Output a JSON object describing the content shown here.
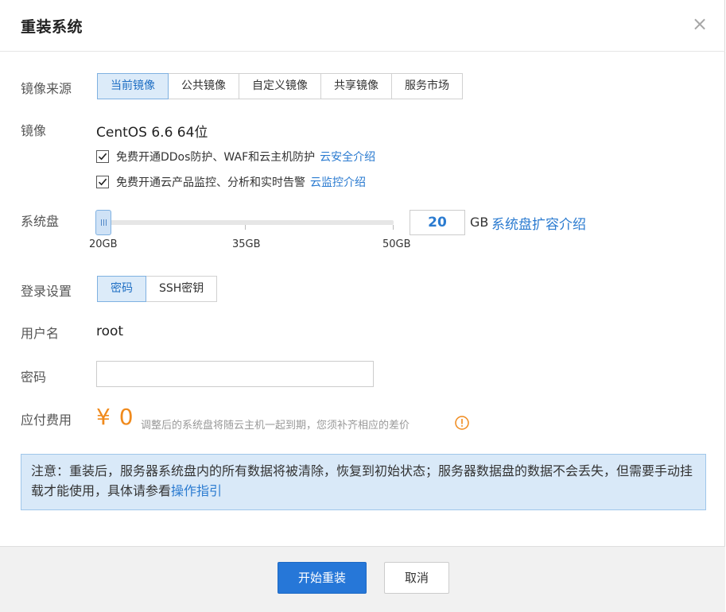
{
  "dialog": {
    "title": "重装系统"
  },
  "labels": {
    "image_source": "镜像来源",
    "image": "镜像",
    "system_disk": "系统盘",
    "login": "登录设置",
    "username": "用户名",
    "password": "密码",
    "fee": "应付费用"
  },
  "image_tabs": [
    "当前镜像",
    "公共镜像",
    "自定义镜像",
    "共享镜像",
    "服务市场"
  ],
  "image_tabs_active": 0,
  "image": {
    "name": "CentOS 6.6 64位",
    "option1_text": "免费开通DDos防护、WAF和云主机防护",
    "option1_link": "云安全介绍",
    "option1_checked": true,
    "option2_text": "免费开通云产品监控、分析和实时告警",
    "option2_link": "云监控介绍",
    "option2_checked": true
  },
  "system_disk": {
    "value": "20",
    "min": 20,
    "max": 50,
    "slider_labels": [
      "20GB",
      "35GB",
      "50GB"
    ],
    "unit": "GB",
    "link": "系统盘扩容介绍"
  },
  "login_tabs": [
    "密码",
    "SSH密钥"
  ],
  "login_tabs_active": 0,
  "username": "root",
  "password": {
    "value": "",
    "placeholder": ""
  },
  "fee": {
    "amount": "¥ 0",
    "note": "调整后的系统盘将随云主机一起到期，您须补齐相应的差价"
  },
  "notice": {
    "text": "注意：重装后，服务器系统盘内的所有数据将被清除，恢复到初始状态；服务器数据盘的数据不会丢失，但需要手动挂载才能使用，具体请参看",
    "link": "操作指引"
  },
  "footer": {
    "start": "开始重装",
    "cancel": "取消"
  },
  "colors": {
    "accent": "#2677d8",
    "link": "#2b7bd0",
    "price": "#f08a1c",
    "notice_bg": "#d9e9f8"
  },
  "icons": {
    "close": "close-icon",
    "check": "check-icon",
    "info": "info-icon"
  }
}
